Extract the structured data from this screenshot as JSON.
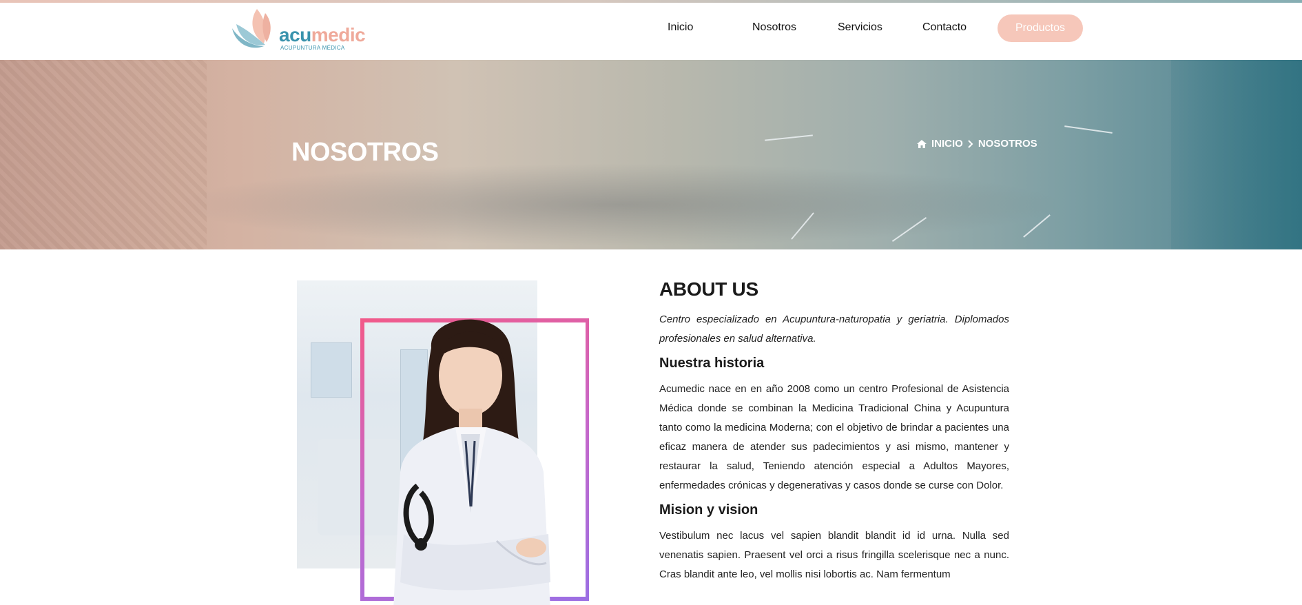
{
  "brand": {
    "name_part1": "acu",
    "name_part2": "medic",
    "tagline": "ACUPUNTURA MÉDICA"
  },
  "nav": {
    "items": [
      {
        "label": "Inicio"
      },
      {
        "label": "Nosotros"
      },
      {
        "label": "Servicios"
      },
      {
        "label": "Contacto"
      }
    ],
    "cta_label": "Productos"
  },
  "hero": {
    "title": "NOSOTROS",
    "breadcrumb": {
      "home_icon": "home-icon",
      "home_label": "INICIO",
      "separator_icon": "chevron-right-icon",
      "current_label": "NOSOTROS"
    }
  },
  "about": {
    "heading": "ABOUT US",
    "intro": "Centro especializado en Acupuntura-naturopatia y geriatria. Diplomados profesionales en salud alternativa.",
    "history_heading": "Nuestra historia",
    "history_text": "Acumedic nace en en año 2008 como un centro Profesional de Asistencia Médica donde se combinan la Medicina Tradicional China y Acupuntura tanto como la medicina Moderna; con el objetivo de brindar a pacientes una eficaz manera de atender sus padecimientos y asi mismo, mantener y restaurar la salud, Teniendo atención especial a Adultos Mayores, enfermedades crónicas y degenerativas y casos donde se curse con Dolor.",
    "mission_heading": "Mision y vision",
    "mission_text": "Vestibulum nec lacus vel sapien blandit blandit id id urna. Nulla sed venenatis sapien. Praesent vel orci a risus fringilla scelerisque nec a nunc. Cras blandit ante leo, vel mollis nisi lobortis ac. Nam fermentum"
  },
  "colors": {
    "brand_teal": "#3a93ad",
    "brand_pink": "#efa99a",
    "cta_bg": "#f6c7ba",
    "frame_gradient_start": "#f15a8a",
    "frame_gradient_end": "#9c6fe3"
  }
}
